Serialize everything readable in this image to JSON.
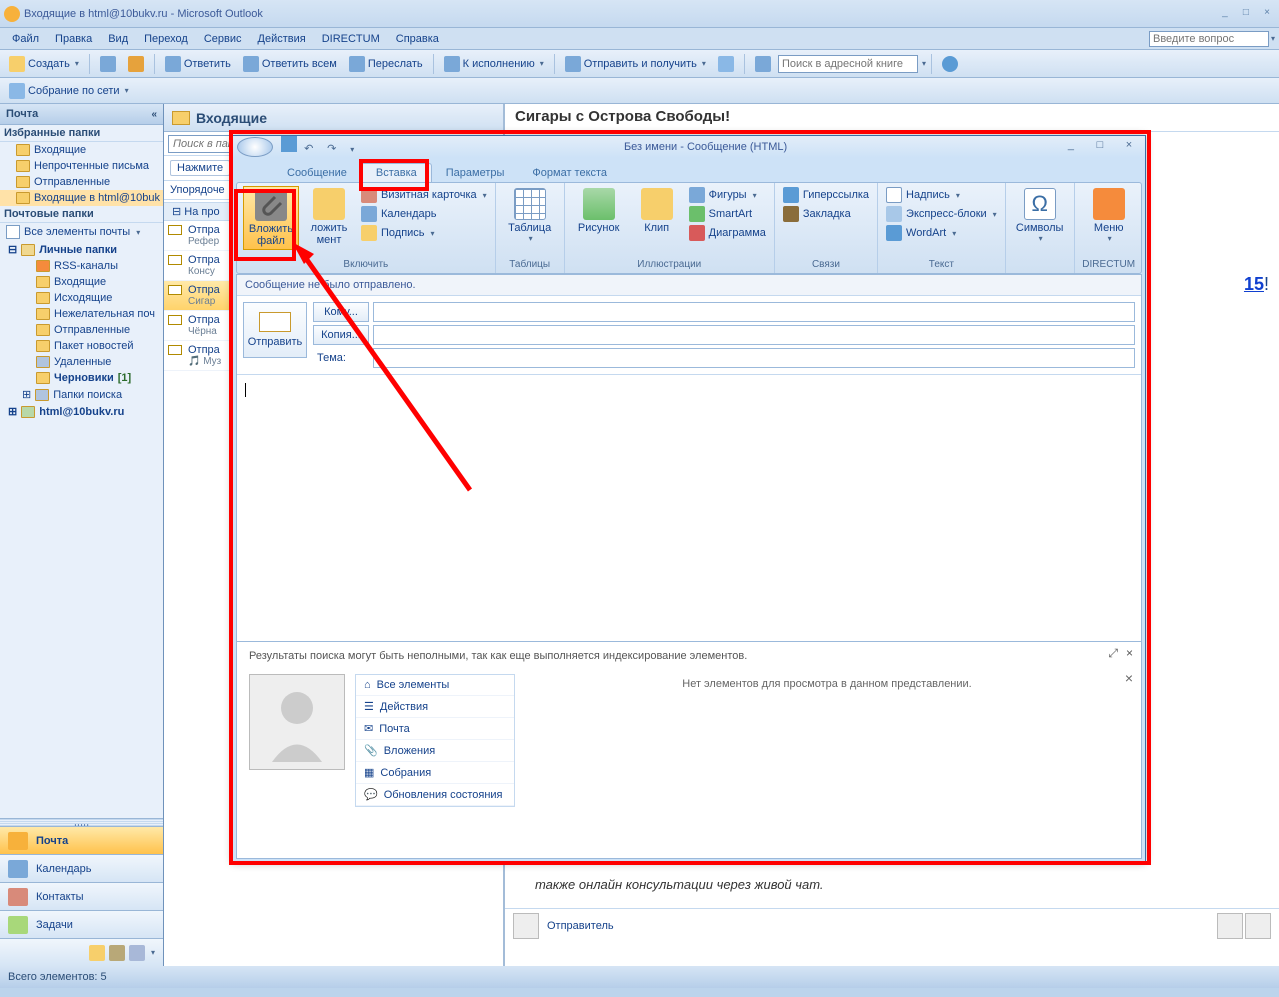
{
  "window": {
    "title": "Входящие в html@10bukv.ru - Microsoft Outlook",
    "question_placeholder": "Введите вопрос"
  },
  "menu": [
    "Файл",
    "Правка",
    "Вид",
    "Переход",
    "Сервис",
    "Действия",
    "DIRECTUM",
    "Справка"
  ],
  "toolbar": {
    "create": "Создать",
    "reply": "Ответить",
    "reply_all": "Ответить всем",
    "forward": "Переслать",
    "followup": "К исполнению",
    "sendreceive": "Отправить и получить",
    "addr_search_ph": "Поиск в адресной книге"
  },
  "toolbar2": {
    "webmeet": "Собрание по сети"
  },
  "nav": {
    "header": "Почта",
    "fav_header": "Избранные папки",
    "fav": [
      "Входящие",
      "Непрочтенные письма",
      "Отправленные",
      "Входящие в html@10buk"
    ],
    "mail_header": "Почтовые папки",
    "all_items": "Все элементы почты",
    "tree_root": "Личные папки",
    "tree": [
      "RSS-каналы",
      "Входящие",
      "Исходящие",
      "Нежелательная поч",
      "Отправленные",
      "Пакет новостей",
      "Удаленные"
    ],
    "drafts": "Черновики",
    "drafts_count": "[1]",
    "search_folders": "Папки поиска",
    "account": "html@10bukv.ru",
    "btns": {
      "mail": "Почта",
      "cal": "Календарь",
      "contacts": "Контакты",
      "tasks": "Задачи"
    }
  },
  "inbox": {
    "title": "Входящие",
    "search_ph": "Поиск в папке \"Входящие\"",
    "hint": "Нажмите",
    "sort": "Упорядоче",
    "groups": [
      {
        "label": "На про",
        "items": [
          {
            "from": "Отпра",
            "subj": "Рефер"
          }
        ]
      },
      {
        "label": "",
        "items": [
          {
            "from": "Отпра",
            "subj": "Консу"
          }
        ]
      },
      {
        "label": "",
        "items": [
          {
            "from": "Отпра",
            "subj": "Сигар",
            "sel": true
          }
        ]
      },
      {
        "label": "",
        "items": [
          {
            "from": "Отпра",
            "subj": "Чёрна"
          }
        ]
      },
      {
        "label": "",
        "items": [
          {
            "from": "Отпра",
            "subj": "Муз"
          }
        ]
      }
    ]
  },
  "preview": {
    "subject": "Сигары с Острова Свободы!",
    "partial_link": "15",
    "body_line": "также онлайн консультации через живой чат.",
    "sender_label": "Отправитель"
  },
  "compose": {
    "title": "Без имени - Сообщение (HTML)",
    "tabs": [
      "Сообщение",
      "Вставка",
      "Параметры",
      "Формат текста"
    ],
    "ribbon": {
      "attach_file": "Вложить файл",
      "attach_item": "ложить мент",
      "bizcard": "Визитная карточка",
      "calendar": "Календарь",
      "signature": "Подпись",
      "include_grp": "Включить",
      "table": "Таблица",
      "tables_grp": "Таблицы",
      "picture": "Рисунок",
      "clip": "Клип",
      "shapes": "Фигуры",
      "smartart": "SmartArt",
      "chart": "Диаграмма",
      "illus_grp": "Иллюстрации",
      "hyperlink": "Гиперссылка",
      "bookmark": "Закладка",
      "links_grp": "Связи",
      "textbox": "Надпись",
      "quickparts": "Экспресс-блоки",
      "wordart": "WordArt",
      "text_grp": "Текст",
      "symbols": "Символы",
      "directum": "Меню",
      "directum_grp": "DIRECTUM"
    },
    "notice": "Сообщение не было отправлено.",
    "send": "Отправить",
    "to_btn": "Кому...",
    "cc_btn": "Копия...",
    "subject_lbl": "Тема:"
  },
  "ppane": {
    "indexing": "Результаты поиска могут быть неполными, так как еще выполняется индексирование элементов.",
    "noitems": "Нет элементов для просмотра в данном представлении.",
    "tabs": [
      "Все элементы",
      "Действия",
      "Почта",
      "Вложения",
      "Собрания",
      "Обновления состояния"
    ]
  },
  "status": {
    "total": "Всего элементов: 5"
  }
}
